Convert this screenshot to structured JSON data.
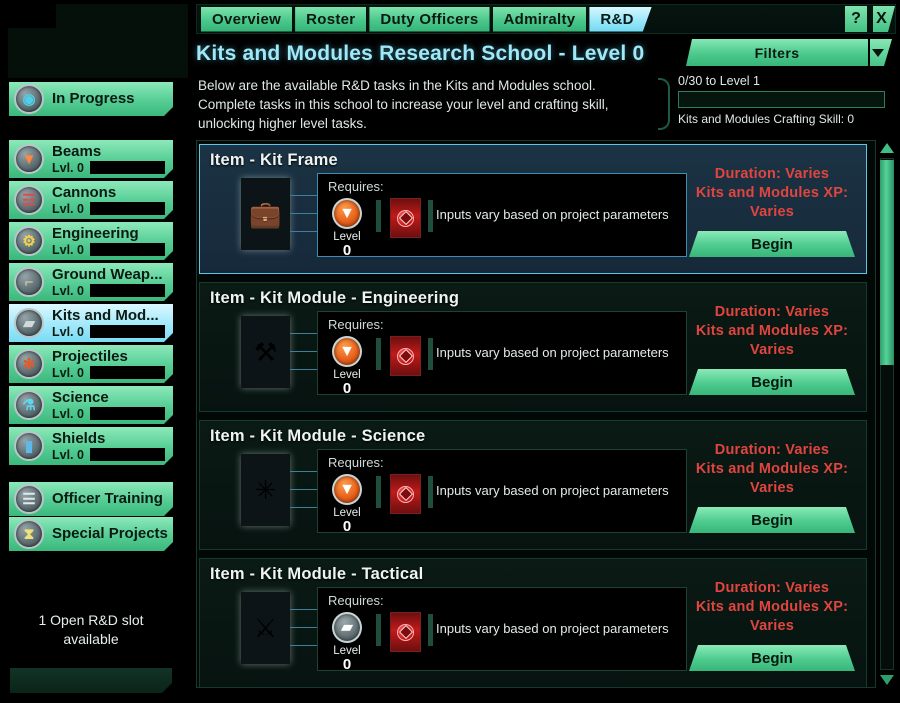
{
  "window": {
    "help_label": "?",
    "close_label": "X"
  },
  "tabs": [
    {
      "label": "Overview",
      "active": false
    },
    {
      "label": "Roster",
      "active": false
    },
    {
      "label": "Duty Officers",
      "active": false
    },
    {
      "label": "Admiralty",
      "active": false
    },
    {
      "label": "R&D",
      "active": true
    }
  ],
  "header": {
    "title": "Kits and Modules Research School - Level 0",
    "filters_label": "Filters"
  },
  "description": "Below are the available R&D tasks in the Kits and Modules school. Complete tasks in this school to increase your level and crafting skill, unlocking higher level tasks.",
  "progress": {
    "to_next_level": "0/30 to Level 1",
    "crafting_skill": "Kits and Modules Crafting Skill: 0",
    "value": 0,
    "max": 30
  },
  "sidebar": {
    "in_progress": {
      "label": "In Progress",
      "icon": "in-progress-icon",
      "glyph": "◉",
      "glyph_color": "#4fd0e8"
    },
    "schools": [
      {
        "label": "Beams",
        "level_label": "Lvl. 0",
        "icon": "beams-icon",
        "glyph": "▼",
        "glyph_color": "#ff8a3c",
        "selected": false
      },
      {
        "label": "Cannons",
        "level_label": "Lvl. 0",
        "icon": "cannons-icon",
        "glyph": "☲",
        "glyph_color": "#e04a4a",
        "selected": false
      },
      {
        "label": "Engineering",
        "level_label": "Lvl. 0",
        "icon": "engineering-icon",
        "glyph": "⚙",
        "glyph_color": "#f2d24a",
        "selected": false
      },
      {
        "label": "Ground Weap...",
        "level_label": "Lvl. 0",
        "icon": "ground-weapons-icon",
        "glyph": "⌐",
        "glyph_color": "#e8d9a8",
        "selected": false
      },
      {
        "label": "Kits and Mod...",
        "level_label": "Lvl. 0",
        "icon": "kits-modules-icon",
        "glyph": "▰",
        "glyph_color": "#cfd9dc",
        "selected": true
      },
      {
        "label": "Projectiles",
        "level_label": "Lvl. 0",
        "icon": "projectiles-icon",
        "glyph": "✻",
        "glyph_color": "#e05a2a",
        "selected": false
      },
      {
        "label": "Science",
        "level_label": "Lvl. 0",
        "icon": "science-icon",
        "glyph": "⚗",
        "glyph_color": "#5fd8ef",
        "selected": false
      },
      {
        "label": "Shields",
        "level_label": "Lvl. 0",
        "icon": "shields-icon",
        "glyph": "▮",
        "glyph_color": "#5fb8e8",
        "selected": false
      }
    ],
    "extras": [
      {
        "label": "Officer Training",
        "icon": "officer-training-icon",
        "glyph": "☰",
        "glyph_color": "#dfe8ea"
      },
      {
        "label": "Special Projects",
        "icon": "special-projects-icon",
        "glyph": "⧗",
        "glyph_color": "#f0e07a"
      }
    ],
    "slot_info": "1 Open R&D slot available"
  },
  "tasks": [
    {
      "title": "Item - Kit Frame",
      "selected": true,
      "item_icon": "kit-frame-icon",
      "item_glyph": "💼",
      "requires_label": "Requires:",
      "level_label": "Level",
      "level_value": "0",
      "level_badge": "beams-badge",
      "badge_grey": false,
      "badge_glyph": "▼",
      "inputs_text": "Inputs vary based on project parameters",
      "duration_text": "Duration: Varies",
      "xp_text": "Kits and Modules XP: Varies",
      "begin_label": "Begin"
    },
    {
      "title": "Item - Kit Module - Engineering",
      "selected": false,
      "item_icon": "kit-module-engineering-icon",
      "item_glyph": "⚒",
      "requires_label": "Requires:",
      "level_label": "Level",
      "level_value": "0",
      "level_badge": "beams-badge",
      "badge_grey": false,
      "badge_glyph": "▼",
      "inputs_text": "Inputs vary based on project parameters",
      "duration_text": "Duration: Varies",
      "xp_text": "Kits and Modules XP: Varies",
      "begin_label": "Begin"
    },
    {
      "title": "Item - Kit Module - Science",
      "selected": false,
      "item_icon": "kit-module-science-icon",
      "item_glyph": "✳",
      "requires_label": "Requires:",
      "level_label": "Level",
      "level_value": "0",
      "level_badge": "beams-badge",
      "badge_grey": false,
      "badge_glyph": "▼",
      "inputs_text": "Inputs vary based on project parameters",
      "duration_text": "Duration: Varies",
      "xp_text": "Kits and Modules XP: Varies",
      "begin_label": "Begin"
    },
    {
      "title": "Item - Kit Module - Tactical",
      "selected": false,
      "item_icon": "kit-module-tactical-icon",
      "item_glyph": "⚔",
      "requires_label": "Requires:",
      "level_label": "Level",
      "level_value": "0",
      "level_badge": "kits-modules-badge",
      "badge_grey": true,
      "badge_glyph": "▰",
      "inputs_text": "Inputs vary based on project parameters",
      "duration_text": "Duration: Varies",
      "xp_text": "Kits and Modules XP: Varies",
      "begin_label": "Begin"
    }
  ],
  "colors": {
    "accent_green": "#4ecb8e",
    "accent_cyan": "#9fe8f7",
    "danger_red": "#e0453f",
    "panel_dark": "#0a1a14"
  }
}
